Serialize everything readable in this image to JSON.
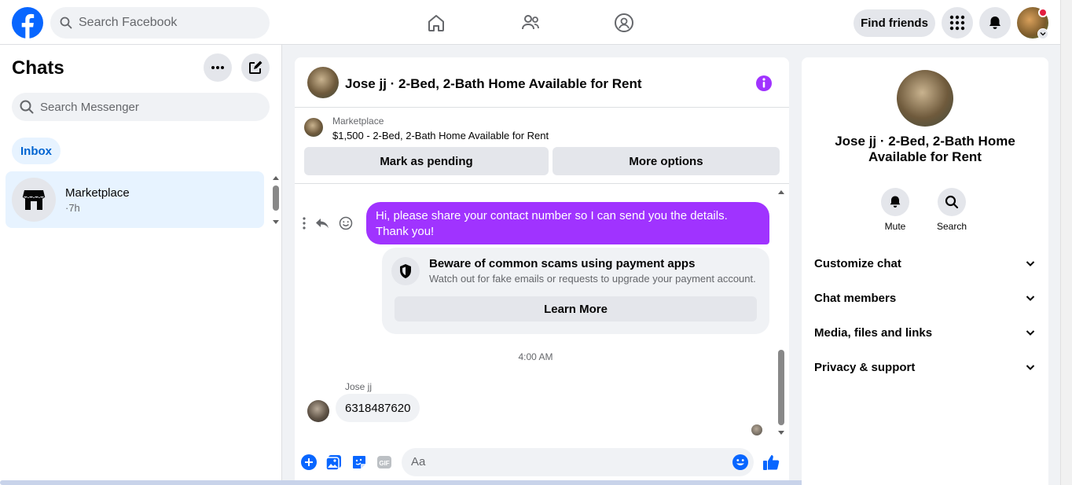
{
  "topbar": {
    "search_placeholder": "Search Facebook",
    "find_friends": "Find friends",
    "brand_color": "#0866ff"
  },
  "sidebar": {
    "title": "Chats",
    "search_placeholder": "Search Messenger",
    "filter": "Inbox",
    "items": [
      {
        "name": "Marketplace",
        "time": "·7h"
      }
    ]
  },
  "conversation": {
    "title": "Jose jj · 2-Bed, 2-Bath Home Available for Rent",
    "listing": {
      "category": "Marketplace",
      "description": "$1,500 - 2-Bed, 2-Bath Home Available for Rent",
      "mark_pending": "Mark as pending",
      "more_options": "More options"
    },
    "messages": {
      "partial_timestamp": "...",
      "outgoing_text": "Hi, please share your contact number so I can send you the details. Thank you!",
      "scam_warning": {
        "title": "Beware of common scams using payment apps",
        "subtitle": "Watch out for fake emails or requests to upgrade your payment account.",
        "button": "Learn More"
      },
      "timestamp": "4:00 AM",
      "sender_name": "Jose jj",
      "incoming_text": "6318487620"
    },
    "composer_placeholder": "Aa",
    "accent_color": "#a033ff"
  },
  "details": {
    "name": "Jose jj · 2-Bed, 2-Bath Home Available for Rent",
    "actions": [
      {
        "label": "Mute",
        "icon": "bell-icon"
      },
      {
        "label": "Search",
        "icon": "search-icon"
      }
    ],
    "sections": [
      "Customize chat",
      "Chat members",
      "Media, files and links",
      "Privacy & support"
    ]
  }
}
